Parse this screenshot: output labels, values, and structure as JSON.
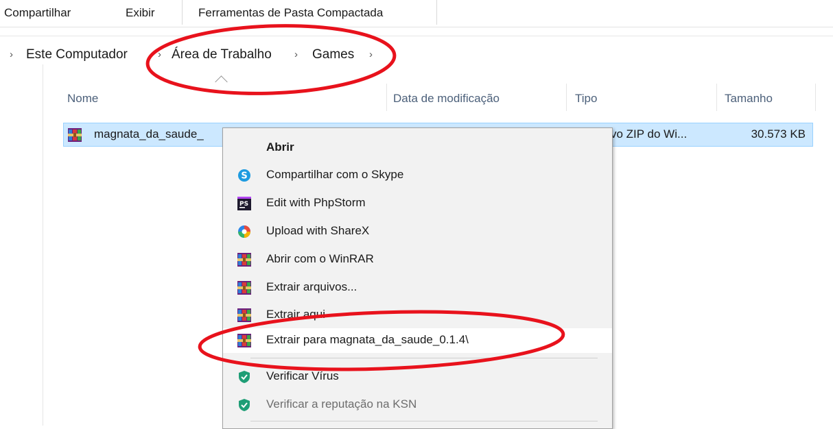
{
  "ribbon": {
    "tabs": [
      "Compartilhar",
      "Exibir",
      "Ferramentas de Pasta Compactada"
    ]
  },
  "breadcrumb": {
    "items": [
      "Este Computador",
      "Área de Trabalho",
      "Games"
    ]
  },
  "columns": {
    "name": "Nome",
    "modified": "Data de modificação",
    "type": "Tipo",
    "size": "Tamanho"
  },
  "file": {
    "name": "magnata_da_saude_",
    "type": "vo ZIP do Wi...",
    "size": "30.573 KB",
    "icon": "winrar-archive-icon"
  },
  "context_menu": {
    "items": [
      {
        "label": "Abrir",
        "icon": "none",
        "bold": true
      },
      {
        "label": "Compartilhar com o Skype",
        "icon": "skype-icon"
      },
      {
        "label": "Edit with PhpStorm",
        "icon": "phpstorm-icon"
      },
      {
        "label": "Upload with ShareX",
        "icon": "sharex-icon"
      },
      {
        "label": "Abrir com o WinRAR",
        "icon": "winrar-icon"
      },
      {
        "label": "Extrair arquivos...",
        "icon": "winrar-icon"
      },
      {
        "label": "Extrair aqui",
        "icon": "winrar-icon"
      },
      {
        "label": "Extrair para magnata_da_saude_0.1.4\\",
        "icon": "winrar-icon",
        "highlighted": true
      },
      {
        "label": "Verificar Vírus",
        "icon": "kaspersky-shield-icon"
      },
      {
        "label": "Verificar a reputação na KSN",
        "icon": "kaspersky-shield-icon",
        "disabled": true
      }
    ]
  },
  "colors": {
    "selection_bg": "#cce8ff",
    "selection_border": "#99d1ff",
    "menu_bg": "#f2f2f2",
    "annotation_red": "#e8121c",
    "header_text": "#4c607a"
  }
}
